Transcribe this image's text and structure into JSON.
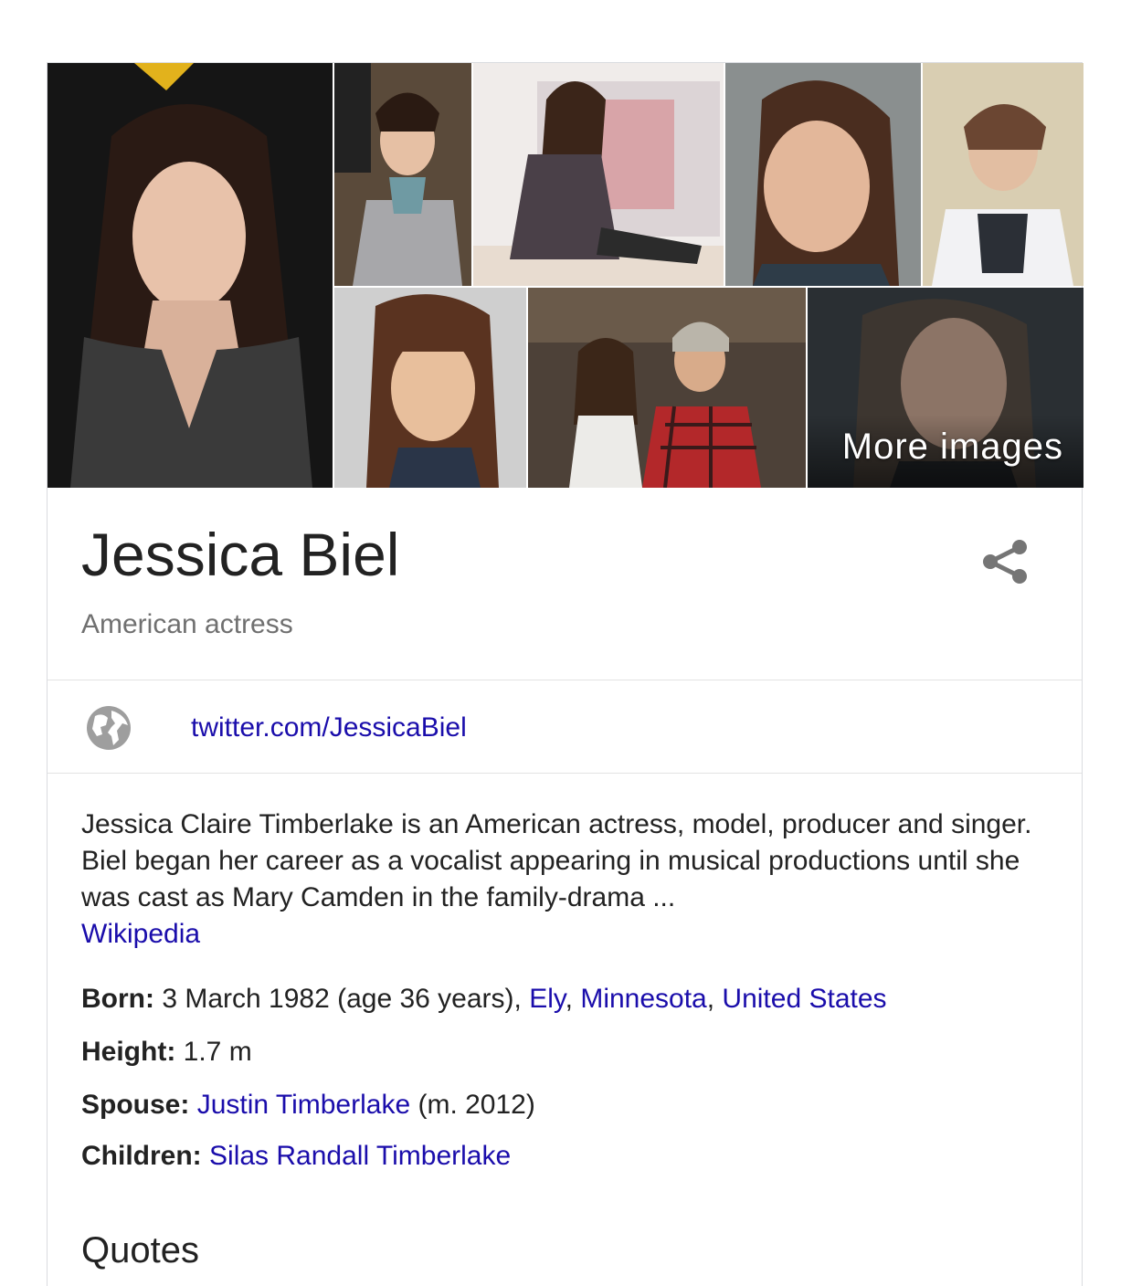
{
  "images": {
    "more_label": "More images"
  },
  "entity": {
    "name": "Jessica Biel",
    "type": "American actress"
  },
  "website": {
    "url": "twitter.com/JessicaBiel"
  },
  "description": {
    "text": "Jessica Claire Timberlake is an American actress, model, producer and singer. Biel began her career as a vocalist appearing in musical productions until she was cast as Mary Camden in the family-drama ...",
    "source": "Wikipedia"
  },
  "facts": {
    "born": {
      "label": "Born:",
      "text": " 3 March 1982 (age 36 years), ",
      "place1": "Ely",
      "sep1": ", ",
      "place2": "Minnesota",
      "sep2": ", ",
      "place3": "United States"
    },
    "height": {
      "label": "Height:",
      "value": " 1.7 m"
    },
    "spouse": {
      "label": "Spouse:",
      "name": "Justin Timberlake",
      "suffix": " (m. 2012)"
    },
    "children": {
      "label": "Children:",
      "name": "Silas Randall Timberlake"
    }
  },
  "sections": {
    "quotes_heading": "Quotes"
  },
  "colors": {
    "link": "#1a0dab",
    "text": "#222222",
    "muted": "#707070",
    "border": "#dadce0"
  }
}
